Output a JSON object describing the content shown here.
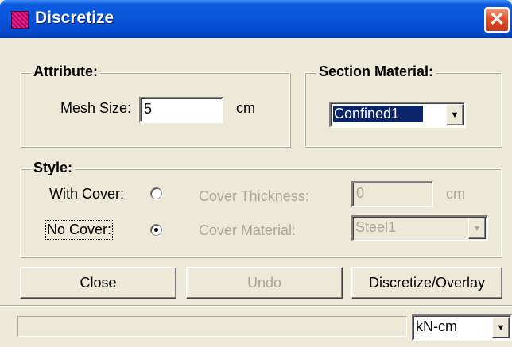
{
  "window": {
    "title": "Discretize",
    "close_glyph": "✕"
  },
  "attribute": {
    "legend": "Attribute:",
    "mesh_size_label": "Mesh Size:",
    "mesh_size_value": "5",
    "mesh_size_unit": "cm"
  },
  "section_material": {
    "legend": "Section Material:",
    "selected": "Confined1"
  },
  "style": {
    "legend": "Style:",
    "with_cover_label": "With Cover:",
    "with_cover_checked": false,
    "no_cover_label": "No Cover:",
    "no_cover_checked": true,
    "cover_thickness_label": "Cover Thickness:",
    "cover_thickness_value": "0",
    "cover_thickness_unit": "cm",
    "cover_material_label": "Cover Material:",
    "cover_material_value": "Steel1"
  },
  "buttons": {
    "close": "Close",
    "undo": "Undo",
    "discretize": "Discretize/Overlay"
  },
  "statusbar": {
    "units": "kN-cm"
  },
  "icons": {
    "dropdown_arrow": "▼"
  },
  "colors": {
    "titlebar": "#0a54d8",
    "selection": "#0a246a",
    "app_icon": "#d2147a",
    "close_button": "#e0502c"
  }
}
